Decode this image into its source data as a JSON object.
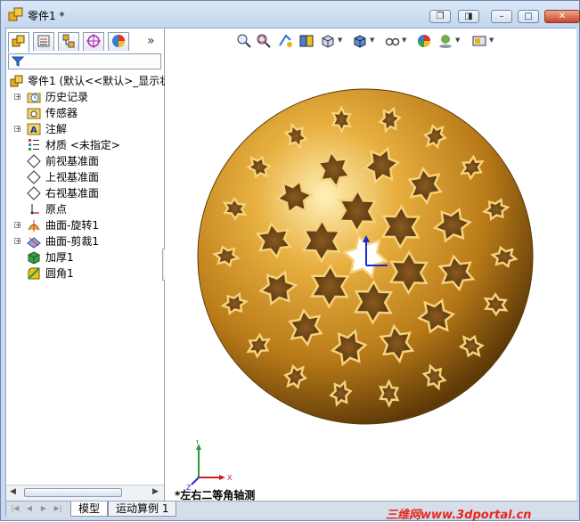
{
  "window": {
    "title": "零件1 *",
    "controls": [
      "restore-doc",
      "tile-doc",
      "minimize",
      "maximize",
      "close"
    ]
  },
  "feature_manager": {
    "tabs": [
      "FeatureManager",
      "PropertyManager",
      "ConfigurationManager",
      "DimXpertManager",
      "DisplayManager"
    ],
    "more_symbol": "»",
    "root": "零件1 (默认<<默认>_显示状",
    "items": [
      {
        "label": "历史记录",
        "icon": "history-folder-icon",
        "expandable": true
      },
      {
        "label": "传感器",
        "icon": "sensor-icon",
        "expandable": false
      },
      {
        "label": "注解",
        "icon": "annotations-icon",
        "expandable": true
      },
      {
        "label": "材质 <未指定>",
        "icon": "material-icon",
        "expandable": false
      },
      {
        "label": "前视基准面",
        "icon": "plane-icon",
        "expandable": false
      },
      {
        "label": "上视基准面",
        "icon": "plane-icon",
        "expandable": false
      },
      {
        "label": "右视基准面",
        "icon": "plane-icon",
        "expandable": false
      },
      {
        "label": "原点",
        "icon": "origin-icon",
        "expandable": false
      },
      {
        "label": "曲面-旋转1",
        "icon": "surface-revolve-icon",
        "expandable": true
      },
      {
        "label": "曲面-剪裁1",
        "icon": "surface-trim-icon",
        "expandable": true
      },
      {
        "label": "加厚1",
        "icon": "thicken-icon",
        "expandable": false
      },
      {
        "label": "圆角1",
        "icon": "fillet-icon",
        "expandable": false
      }
    ]
  },
  "viewport": {
    "toolbar": [
      "zoom-to-fit-icon",
      "zoom-to-area-icon",
      "previous-view-icon",
      "section-view-icon",
      "view-orientation-icon",
      "display-style-icon",
      "hide-show-items-icon",
      "edit-appearance-icon",
      "apply-scene-icon",
      "view-settings-icon"
    ],
    "view_label": "*左右二等角轴测",
    "triad": {
      "x": "X",
      "y": "Y",
      "z": "Z"
    },
    "model_color": "#c8901e"
  },
  "bottom_tabs": [
    "模型",
    "运动算例 1"
  ],
  "watermark": "三维网www.3dportal.cn"
}
